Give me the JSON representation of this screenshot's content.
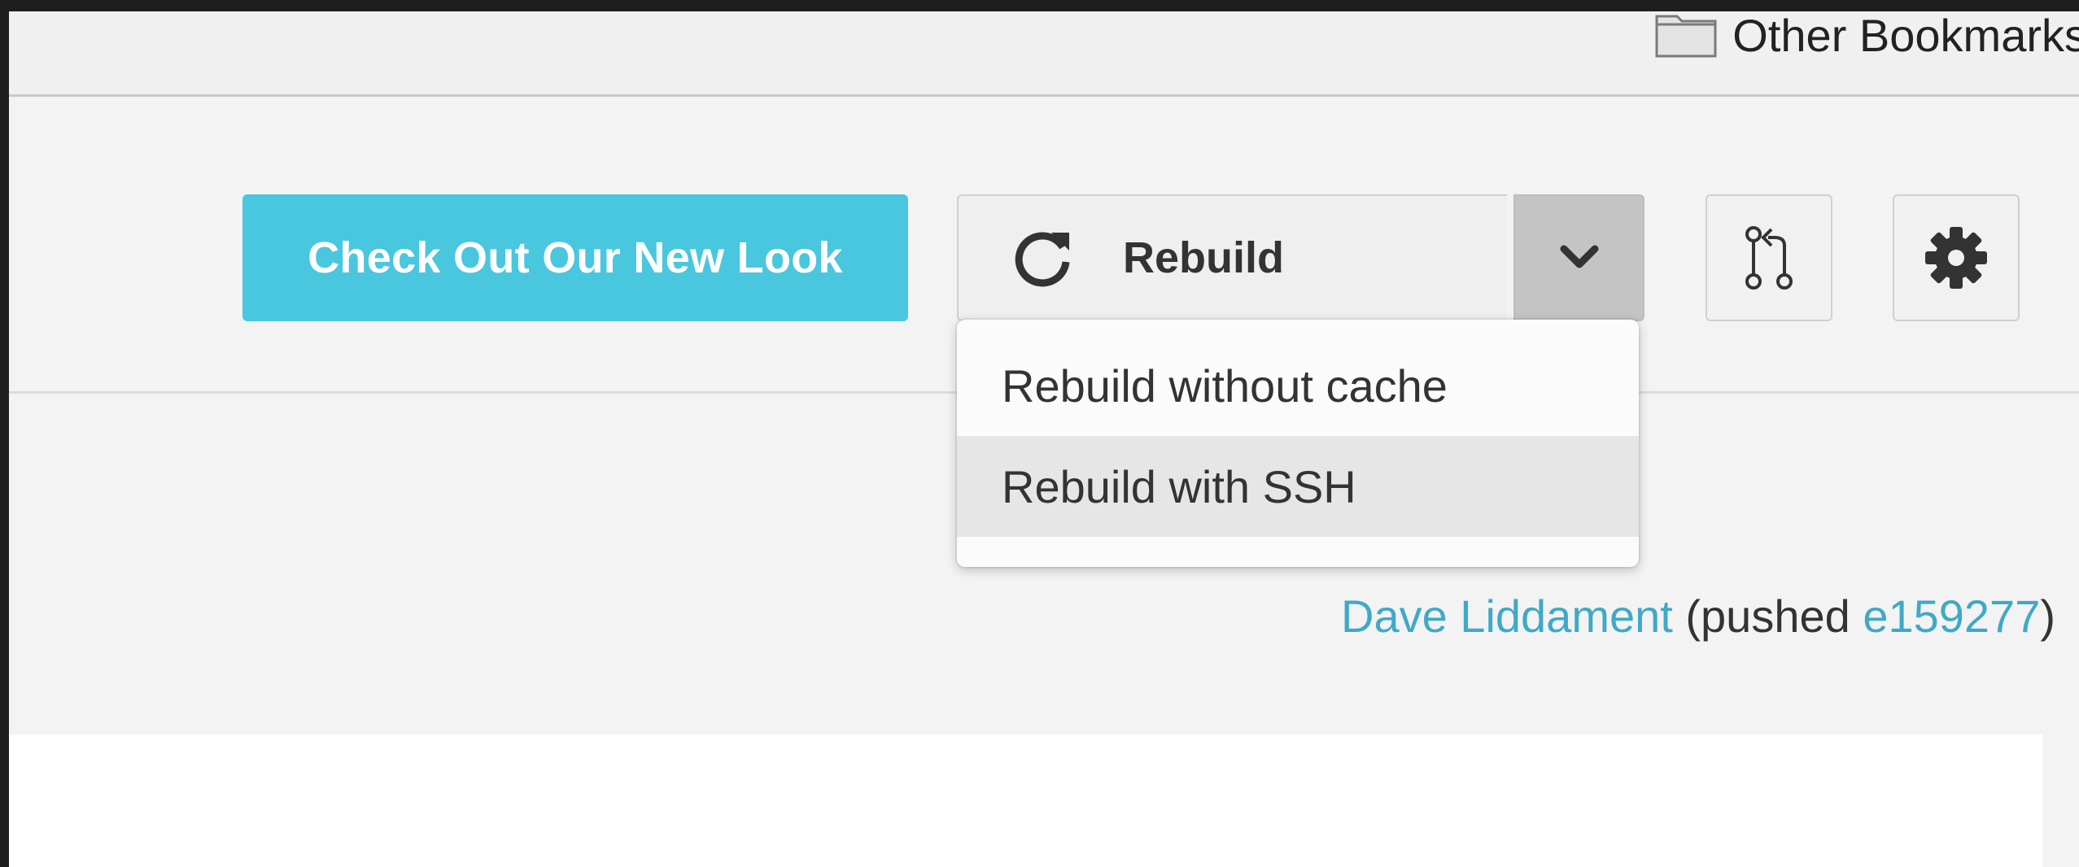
{
  "bookmarks": {
    "other_label": "Other Bookmarks",
    "icon": "folder-icon"
  },
  "header": {
    "cta_label": "Check Out Our New Look",
    "rebuild_label": "Rebuild",
    "rebuild_icon": "refresh-icon",
    "caret_icon": "chevron-down-icon",
    "pr_icon": "pull-request-icon",
    "settings_icon": "gear-icon"
  },
  "dropdown": {
    "items": [
      {
        "label": "Rebuild without cache"
      },
      {
        "label": "Rebuild with SSH"
      }
    ]
  },
  "commit": {
    "author": "Dave Liddament",
    "prefix": " (pushed ",
    "sha": "e159277",
    "suffix": ")"
  },
  "colors": {
    "accent": "#49c7de",
    "link": "#3fa9c6"
  }
}
